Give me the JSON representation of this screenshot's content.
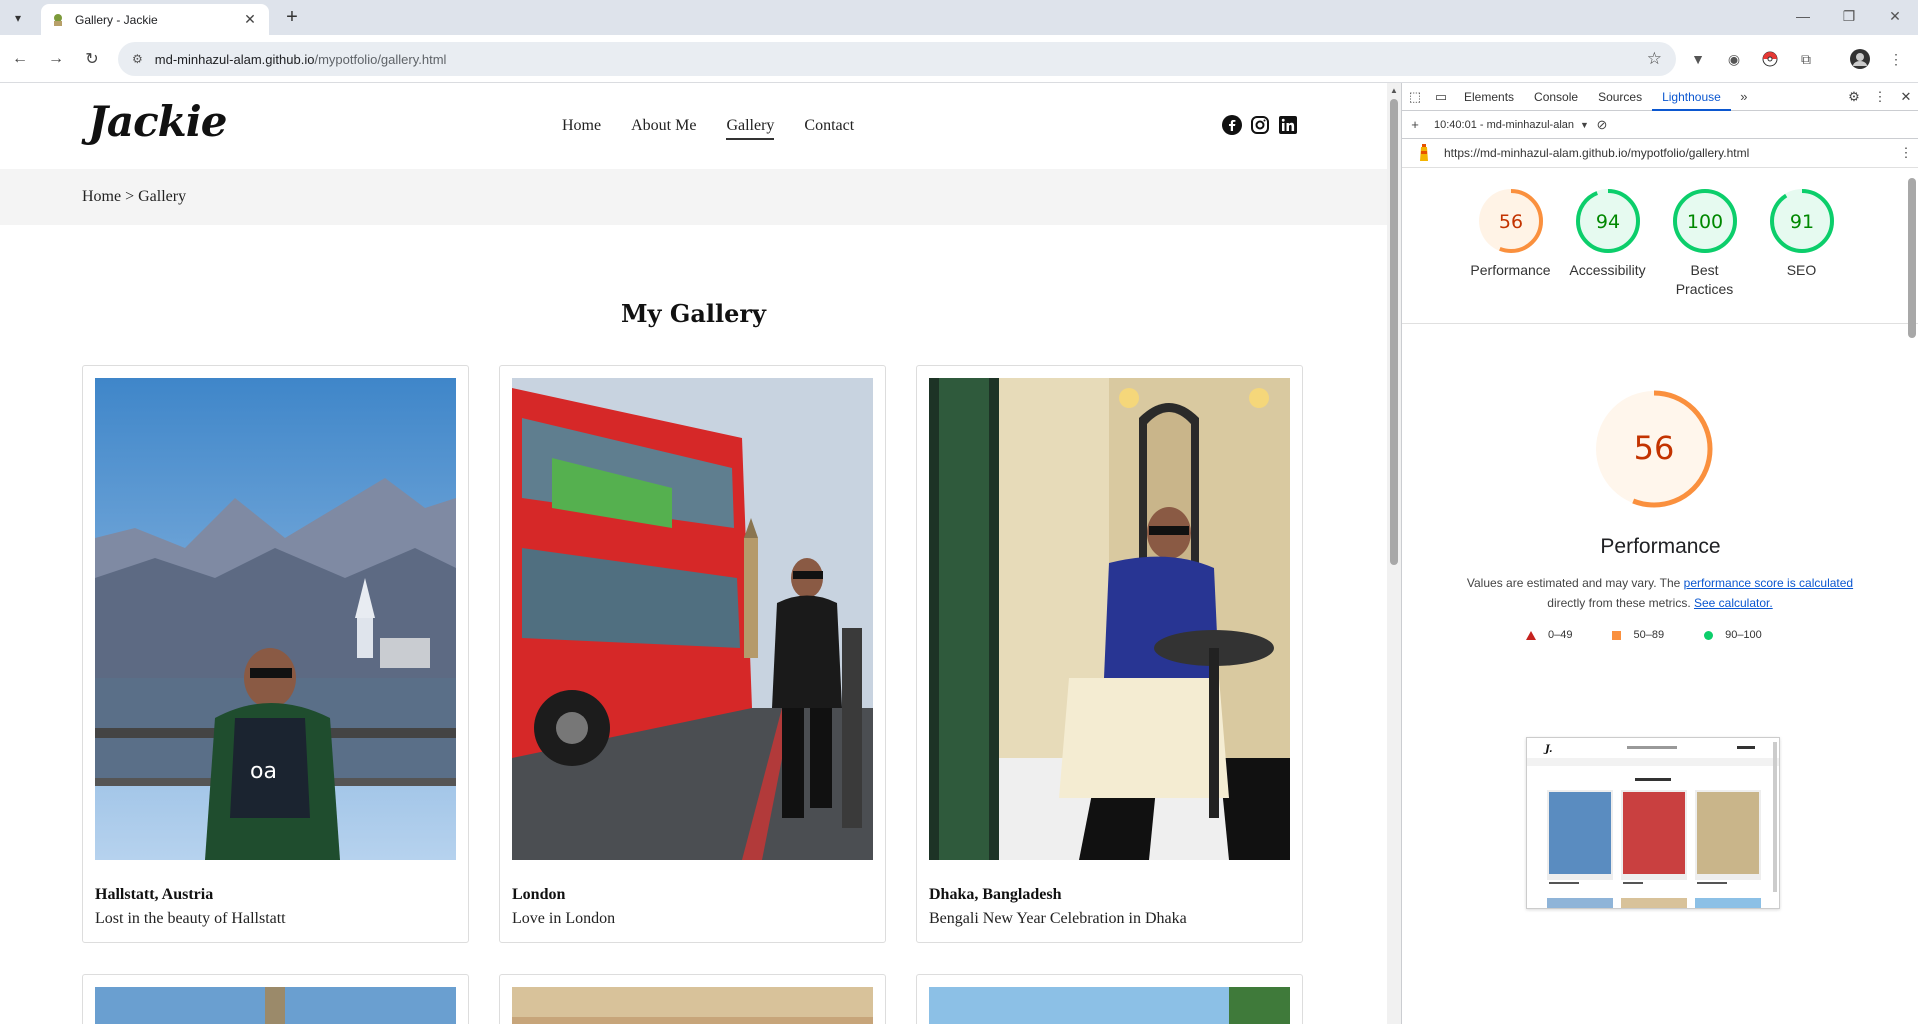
{
  "browser": {
    "tab_title": "Gallery - Jackie",
    "url_host": "md-minhazul-alam.github.io",
    "url_path": "/mypotfolio/gallery.html"
  },
  "site": {
    "logo": "Jackie",
    "nav": {
      "home": "Home",
      "about": "About Me",
      "gallery": "Gallery",
      "contact": "Contact"
    },
    "breadcrumb": "Home > Gallery",
    "gallery_title": "My Gallery",
    "cards": [
      {
        "title": "Hallstatt, Austria",
        "text": "Lost in the beauty of Hallstatt"
      },
      {
        "title": "London",
        "text": "Love in London"
      },
      {
        "title": "Dhaka, Bangladesh",
        "text": "Bengali New Year Celebration in Dhaka"
      }
    ]
  },
  "devtools": {
    "tabs": {
      "elements": "Elements",
      "console": "Console",
      "sources": "Sources",
      "lighthouse": "Lighthouse"
    },
    "run_label": "10:40:01 - md-minhazul-alan",
    "report_url": "https://md-minhazul-alam.github.io/mypotfolio/gallery.html",
    "scores": [
      {
        "value": "56",
        "label": "Performance",
        "color": "#fa903e"
      },
      {
        "value": "94",
        "label": "Accessibility",
        "color": "#0cce6b"
      },
      {
        "value": "100",
        "label": "Best Practices",
        "color": "#0cce6b"
      },
      {
        "value": "91",
        "label": "SEO",
        "color": "#0cce6b"
      }
    ],
    "perf": {
      "value": "56",
      "title": "Performance",
      "desc_pre": "Values are estimated and may vary. The ",
      "desc_link1": "performance score is calculated",
      "desc_mid": " directly from these metrics. ",
      "desc_link2": "See calculator."
    },
    "legend": {
      "fail": "0–49",
      "average": "50–89",
      "pass": "90–100"
    }
  }
}
